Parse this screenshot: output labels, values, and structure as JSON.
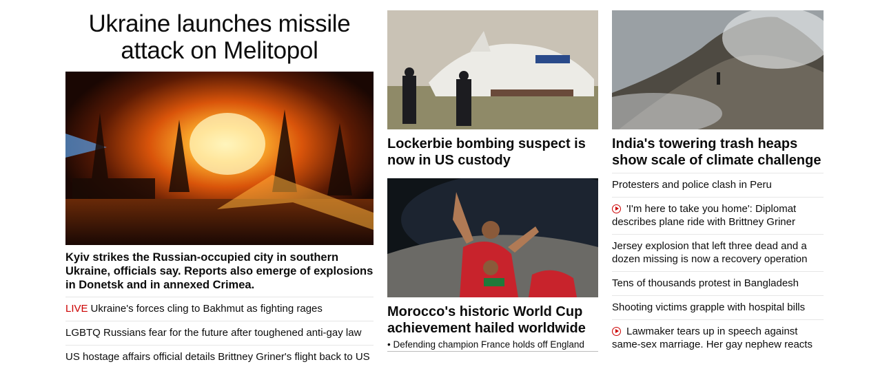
{
  "lead": {
    "headline": "Ukraine launches missile attack on Melitopol",
    "summary": "Kyiv strikes the Russian-occupied city in southern Ukraine, officials say. Reports also emerge of explosions in Donetsk and in annexed Crimea.",
    "links": [
      {
        "prefix": "LIVE",
        "text": "Ukraine's forces cling to Bakhmut as fighting rages"
      },
      {
        "prefix": "",
        "text": "LGBTQ Russians fear for the future after toughened anti-gay law"
      },
      {
        "prefix": "",
        "text": "US hostage affairs official details Brittney Griner's flight back to US"
      }
    ]
  },
  "middle": {
    "story1": {
      "title": "Lockerbie bombing suspect is now in US custody"
    },
    "story2": {
      "title": "Morocco's historic World Cup achievement hailed worldwide",
      "sub": "• Defending champion France holds off England"
    }
  },
  "right": {
    "story": {
      "title": "India's towering trash heaps show scale of climate challenge"
    },
    "links": [
      {
        "video": false,
        "text": "Protesters and police clash in Peru"
      },
      {
        "video": true,
        "text": "'I'm here to take you home': Diplomat describes plane ride with Brittney Griner"
      },
      {
        "video": false,
        "text": "Jersey explosion that left three dead and a dozen missing is now a recovery operation"
      },
      {
        "video": false,
        "text": "Tens of thousands protest in Bangladesh"
      },
      {
        "video": false,
        "text": "Shooting victims grapple with hospital bills"
      },
      {
        "video": true,
        "text": "Lawmaker tears up in speech against same-sex marriage. Her gay nephew reacts"
      }
    ]
  },
  "colors": {
    "live": "#cc0000",
    "text": "#0c0c0c",
    "divider": "#e6e6e6"
  }
}
